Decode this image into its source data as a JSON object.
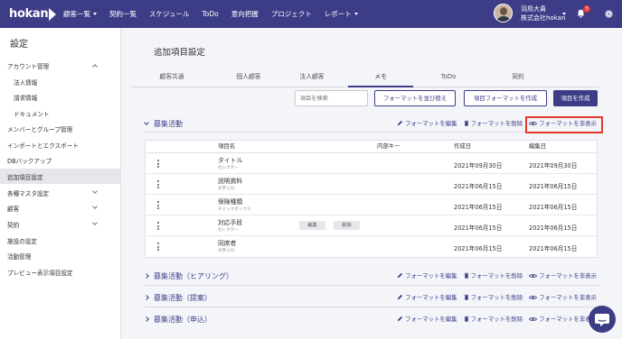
{
  "header": {
    "logo": "hokan",
    "nav": [
      {
        "label": "顧客一覧",
        "dropdown": true
      },
      {
        "label": "契約一覧",
        "dropdown": false
      },
      {
        "label": "スケジュール",
        "dropdown": false
      },
      {
        "label": "ToDo",
        "dropdown": false
      },
      {
        "label": "意向把握",
        "dropdown": false
      },
      {
        "label": "プロジェクト",
        "dropdown": false
      },
      {
        "label": "レポート",
        "dropdown": true
      }
    ],
    "user_name": "羽鳥大貴",
    "company": "株式会社hokan",
    "notification_count": "3",
    "bar_color": "#3d3c87"
  },
  "sidebar": {
    "title": "設定",
    "items": [
      {
        "label": "アカウント管理",
        "level": 0,
        "chevron": "up"
      },
      {
        "label": "法人情報",
        "level": 1
      },
      {
        "label": "請求情報",
        "level": 1
      },
      {
        "label": "ドキュメント",
        "level": 1
      },
      {
        "label": "メンバーとグループ管理",
        "level": 0
      },
      {
        "label": "インポートとエクスポート",
        "level": 0
      },
      {
        "label": "DBバックアップ",
        "level": 0
      },
      {
        "label": "追加項目設定",
        "level": 0,
        "active": true
      },
      {
        "label": "各種マスタ設定",
        "level": 0,
        "chevron": "down"
      },
      {
        "label": "顧客",
        "level": 0,
        "chevron": "down"
      },
      {
        "label": "契約",
        "level": 0,
        "chevron": "down"
      },
      {
        "label": "施設の設定",
        "level": 0
      },
      {
        "label": "活動管理",
        "level": 0
      },
      {
        "label": "プレビュー表示項目設定",
        "level": 0
      }
    ]
  },
  "main": {
    "title": "追加項目設定",
    "tabs": [
      "顧客共通",
      "個人顧客",
      "法人顧客",
      "メモ",
      "ToDo",
      "契約"
    ],
    "active_tab": "メモ",
    "search_placeholder": "項目を検索",
    "buttons": {
      "reorder": "フォーマットを並び替え",
      "create_format": "項目フォーマットを作成",
      "create_item": "項目を作成"
    },
    "actions": {
      "edit": "フォーマットを編集",
      "delete": "フォーマットを削除",
      "hide": "フォーマットを非表示"
    },
    "sections": [
      {
        "title": "募集活動",
        "expanded": true
      },
      {
        "title": "募集活動（ヒアリング）",
        "expanded": false
      },
      {
        "title": "募集活動（提案）",
        "expanded": false
      },
      {
        "title": "募集活動（申込）",
        "expanded": false
      }
    ],
    "table": {
      "headers": [
        "項目名",
        "内部キー",
        "作成日",
        "編集日"
      ],
      "rows": [
        {
          "name": "タイトル",
          "type": "セレクター",
          "created": "2021年09月30日",
          "edited": "2021年09月30日"
        },
        {
          "name": "説明資料",
          "type": "文字入力",
          "created": "2021年06月15日",
          "edited": "2021年06月15日"
        },
        {
          "name": "保険種類",
          "type": "チェックボックス",
          "created": "2021年06月15日",
          "edited": "2021年06月15日"
        },
        {
          "name": "対応手段",
          "type": "セレクター",
          "created": "2021年06月15日",
          "edited": "2021年06月15日",
          "edit_label": "編集",
          "delete_label": "削除"
        },
        {
          "name": "同席者",
          "type": "文字入力",
          "created": "2021年06月15日",
          "edited": "2021年06月15日"
        }
      ]
    },
    "highlight_color": "#e23a2a"
  }
}
